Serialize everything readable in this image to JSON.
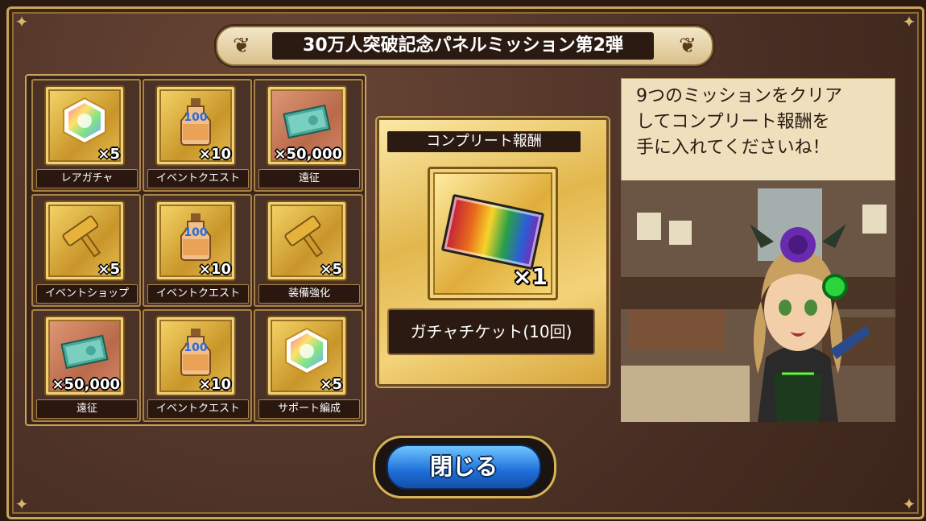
{
  "header": {
    "title": "30万人突破記念パネルミッション第2弾"
  },
  "missions": [
    {
      "label": "レアガチャ",
      "qty": "×5",
      "icon": "crystal-icon"
    },
    {
      "label": "イベントクエスト",
      "qty": "×10",
      "icon": "potion-icon",
      "badge": "100"
    },
    {
      "label": "遠征",
      "qty": "×50,000",
      "icon": "money-icon"
    },
    {
      "label": "イベントショップ",
      "qty": "×5",
      "icon": "hammer-icon"
    },
    {
      "label": "イベントクエスト",
      "qty": "×10",
      "icon": "potion-icon",
      "badge": "100"
    },
    {
      "label": "装備強化",
      "qty": "×5",
      "icon": "hammer-icon"
    },
    {
      "label": "遠征",
      "qty": "×50,000",
      "icon": "money-icon"
    },
    {
      "label": "イベントクエスト",
      "qty": "×10",
      "icon": "potion-icon",
      "badge": "100"
    },
    {
      "label": "サポート編成",
      "qty": "×5",
      "icon": "crystal-icon"
    }
  ],
  "complete_reward": {
    "title": "コンプリート報酬",
    "qty": "×1",
    "item_name": "ガチャチケット(10回)",
    "icon": "gacha-ticket-icon"
  },
  "speech": {
    "lines": [
      "9つのミッションをクリア",
      "してコンプリート報酬を",
      "手に入れてくださいね！"
    ]
  },
  "close_button": {
    "label": "閉じる"
  },
  "colors": {
    "gold": "#c9a35a",
    "frame_brown": "#55392b",
    "button_blue": "#1e6ed8"
  }
}
